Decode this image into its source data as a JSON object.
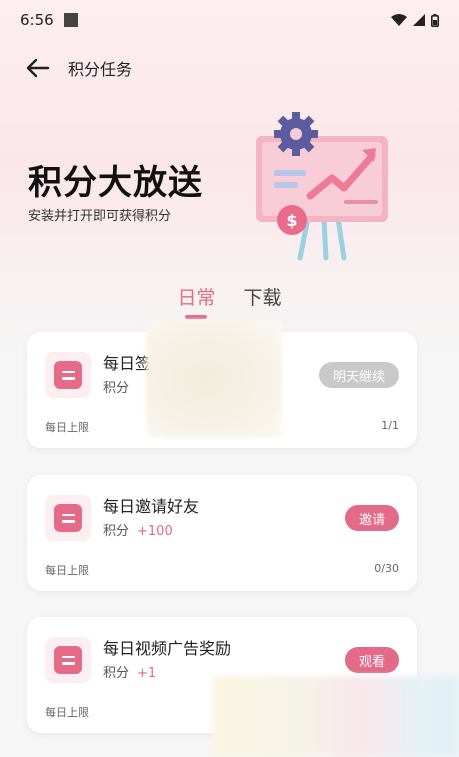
{
  "statusbar": {
    "time": "6:56"
  },
  "header": {
    "title": "积分任务"
  },
  "hero": {
    "title": "积分大放送",
    "subtitle": "安装并打开即可获得积分"
  },
  "tabs": [
    {
      "label": "日常",
      "active": true
    },
    {
      "label": "下载",
      "active": false
    }
  ],
  "tasks": [
    {
      "name": "每日签",
      "points_label": "积分",
      "points_value": "",
      "limit_label": "每日上限",
      "limit_count": "1/1",
      "button": "明天继续",
      "button_style": "gray"
    },
    {
      "name": "每日邀请好友",
      "points_label": "积分",
      "points_value": "+100",
      "limit_label": "每日上限",
      "limit_count": "0/30",
      "button": "邀请",
      "button_style": "pink"
    },
    {
      "name": "每日视频广告奖励",
      "points_label": "积分",
      "points_value": "+1",
      "limit_label": "每日上限",
      "limit_count": "",
      "button": "观看",
      "button_style": "pink"
    }
  ],
  "colors": {
    "accent": "#e36a88",
    "button_disabled": "#c9c9c9",
    "card_bg": "#ffffff"
  },
  "icons": {
    "back": "arrow-left-icon",
    "task": "document-icon",
    "illustration": "presentation-board-icon"
  }
}
